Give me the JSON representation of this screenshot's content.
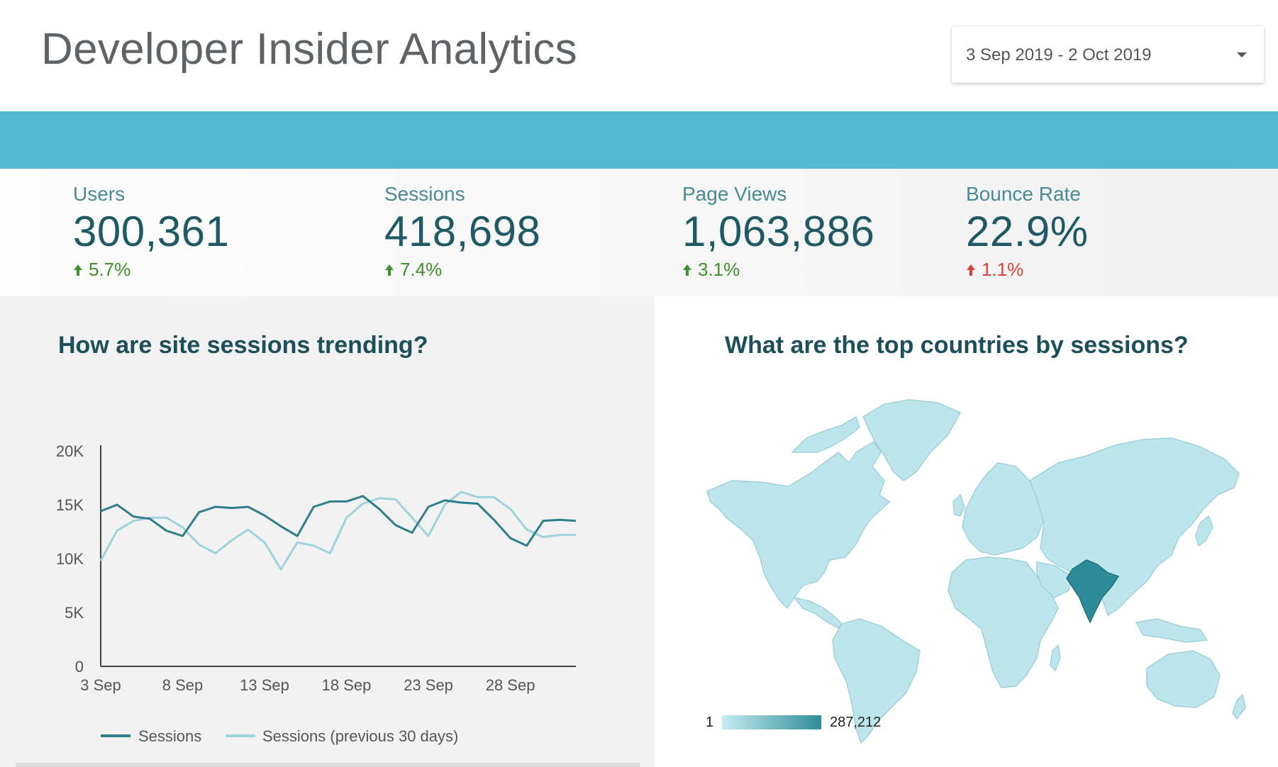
{
  "header": {
    "title": "Developer Insider Analytics",
    "date_range": "3 Sep 2019 - 2 Oct 2019"
  },
  "colors": {
    "band": "#53bad3",
    "sessions_line": "#2e7f8a",
    "previous_line": "#9fd3db",
    "positive": "#3f8f2e",
    "negative": "#d9413a",
    "map_land": "#bde6ec",
    "map_highlight": "#2e8c98"
  },
  "kpis": [
    {
      "label": "Users",
      "value": "300,361",
      "change": "5.7%",
      "direction": "up",
      "sentiment": "good"
    },
    {
      "label": "Sessions",
      "value": "418,698",
      "change": "7.4%",
      "direction": "up",
      "sentiment": "good"
    },
    {
      "label": "Page Views",
      "value": "1,063,886",
      "change": "3.1%",
      "direction": "up",
      "sentiment": "good"
    },
    {
      "label": "Bounce Rate",
      "value": "22.9%",
      "change": "1.1%",
      "direction": "up",
      "sentiment": "bad"
    }
  ],
  "trend_panel": {
    "title": "How are site sessions trending?"
  },
  "map_panel": {
    "title": "What are the top countries by sessions?",
    "legend_min": "1",
    "legend_max": "287,212",
    "highlighted_country": "India"
  },
  "chart_data": {
    "type": "line",
    "x": [
      "3 Sep",
      "4 Sep",
      "5 Sep",
      "6 Sep",
      "7 Sep",
      "8 Sep",
      "9 Sep",
      "10 Sep",
      "11 Sep",
      "12 Sep",
      "13 Sep",
      "14 Sep",
      "15 Sep",
      "16 Sep",
      "17 Sep",
      "18 Sep",
      "19 Sep",
      "20 Sep",
      "21 Sep",
      "22 Sep",
      "23 Sep",
      "24 Sep",
      "25 Sep",
      "26 Sep",
      "27 Sep",
      "28 Sep",
      "29 Sep",
      "30 Sep",
      "1 Oct",
      "2 Oct"
    ],
    "x_tick_labels": [
      "3 Sep",
      "8 Sep",
      "13 Sep",
      "18 Sep",
      "23 Sep",
      "28 Sep"
    ],
    "y_tick_labels": [
      "0",
      "5K",
      "10K",
      "15K",
      "20K"
    ],
    "ylim": [
      0,
      20000
    ],
    "series": [
      {
        "name": "Sessions",
        "values": [
          14400,
          15000,
          13900,
          13700,
          12600,
          12100,
          14300,
          14800,
          14700,
          14800,
          14000,
          13000,
          12100,
          14800,
          15300,
          15300,
          15800,
          14600,
          13100,
          12400,
          14800,
          15400,
          15200,
          15100,
          13600,
          11900,
          11200,
          13500,
          13600,
          13500
        ]
      },
      {
        "name": "Sessions (previous 30 days)",
        "values": [
          9800,
          12600,
          13500,
          13800,
          13800,
          12900,
          11300,
          10500,
          11700,
          12700,
          11500,
          9000,
          11500,
          11200,
          10500,
          13800,
          15100,
          15600,
          15500,
          13800,
          12100,
          15000,
          16200,
          15700,
          15700,
          14600,
          12700,
          12000,
          12200,
          12200
        ]
      }
    ],
    "legend_position": "bottom",
    "grid": false
  }
}
